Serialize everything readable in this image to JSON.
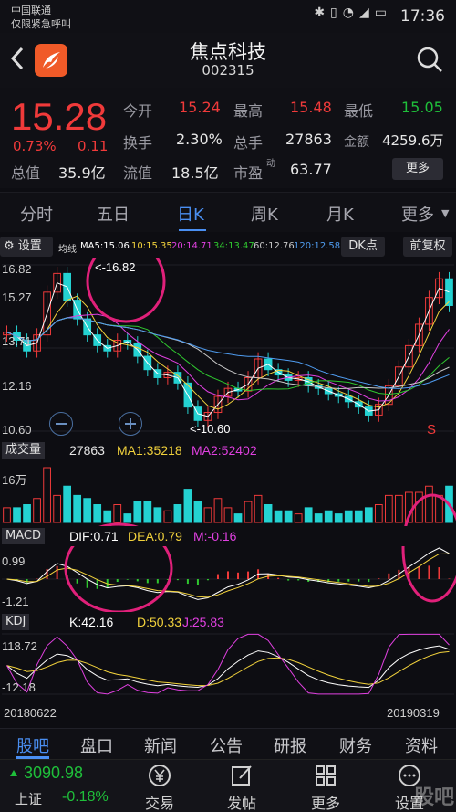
{
  "status_bar": {
    "carrier_line1": "中国联通",
    "carrier_line2": "仅限紧急呼叫",
    "icons": [
      "bluetooth-icon",
      "vibrate-icon",
      "wifi-icon",
      "signal-icon",
      "battery-icon"
    ],
    "time": "17:36"
  },
  "header": {
    "stock_name": "焦点科技",
    "stock_code": "002315"
  },
  "quote": {
    "price": "15.28",
    "change_pct": "0.73%",
    "change": "0.11",
    "rows": [
      [
        {
          "label": "今开",
          "value": "15.24",
          "color": "red"
        },
        {
          "label": "最高",
          "value": "15.48",
          "color": "red"
        },
        {
          "label": "最低",
          "value": "15.05",
          "color": "green"
        }
      ],
      [
        {
          "label": "换手",
          "value": "2.30%",
          "color": "white"
        },
        {
          "label": "总手",
          "value": "27863",
          "color": "white"
        },
        {
          "label": "金额",
          "value": "4259.6万",
          "color": "white"
        }
      ],
      [
        {
          "label": "总值",
          "value": "35.9亿",
          "color": "white"
        },
        {
          "label": "流值",
          "value": "18.5亿",
          "color": "white"
        },
        {
          "label": "市盈",
          "sup": "动",
          "value": "63.77",
          "color": "white"
        }
      ]
    ],
    "more_label": "更多"
  },
  "tabs": [
    "分时",
    "五日",
    "日K",
    "周K",
    "月K",
    "更多"
  ],
  "active_tab": 2,
  "ma": {
    "settings_label": "设置",
    "prefix": "均线",
    "items": [
      {
        "text": "MA5:15.06",
        "color": "#ffffff"
      },
      {
        "text": "10:15.35",
        "color": "#f2d23c"
      },
      {
        "text": "20:14.71",
        "color": "#e040e0"
      },
      {
        "text": "34:13.47",
        "color": "#2fc72f"
      },
      {
        "text": "60:12.76",
        "color": "#c8c8c8"
      },
      {
        "text": "120:12.58",
        "color": "#4f9cf0"
      }
    ],
    "dk_label": "DK点",
    "fq_label": "前复权"
  },
  "kline": {
    "y_labels": [
      "16.82",
      "15.27",
      "13.71",
      "12.16",
      "10.60"
    ],
    "high_mark": "<-16.82",
    "low_mark": "<-10.60",
    "s_marker": "S",
    "zoom_out_icon": "minus-icon",
    "zoom_in_icon": "plus-icon"
  },
  "volume": {
    "name": "成交量",
    "vol": "27863",
    "ma1": "MA1:35218",
    "ma2": "MA2:52402",
    "y_label": "16万"
  },
  "macd": {
    "name": "MACD",
    "dif": "DIF:0.71",
    "dea": "DEA:0.79",
    "m": "M:-0.16",
    "y_top": "0.99",
    "y_bottom": "-1.21"
  },
  "kdj": {
    "name": "KDJ",
    "k": "K:42.16",
    "d": "D:50.33",
    "j": "J:25.83",
    "y_top": "118.72",
    "y_bottom": "-12.18"
  },
  "dates": {
    "start": "20180622",
    "end": "20190319"
  },
  "bottom_tabs": [
    "股吧",
    "盘口",
    "新闻",
    "公告",
    "研报",
    "财务",
    "资料"
  ],
  "toolbar": {
    "index_value": "3090.98",
    "index_name": "上证",
    "index_change": "-0.18%",
    "items": [
      {
        "label": "交易",
        "icon": "yuan-trade-icon"
      },
      {
        "label": "发帖",
        "icon": "edit-post-icon"
      },
      {
        "label": "更多",
        "icon": "grid-more-icon"
      },
      {
        "label": "设置",
        "icon": "settings-dots-icon"
      }
    ]
  },
  "watermark": "股吧",
  "chart_data": {
    "type": "line",
    "title": "",
    "xlabel": "",
    "ylabel": "",
    "x_range": [
      "20180622",
      "20190319"
    ],
    "ylim": [
      10.6,
      16.82
    ],
    "y_ticks": [
      16.82,
      15.27,
      13.71,
      12.16,
      10.6
    ],
    "period_high": 16.82,
    "period_low": 10.6,
    "close_approx": [
      14.3,
      14.0,
      13.6,
      14.2,
      15.8,
      16.5,
      15.5,
      14.8,
      14.2,
      13.8,
      13.6,
      14.0,
      13.9,
      13.4,
      12.9,
      12.6,
      12.8,
      12.4,
      11.5,
      11.0,
      11.3,
      11.9,
      12.2,
      12.1,
      12.6,
      13.3,
      12.9,
      12.7,
      12.5,
      12.6,
      12.3,
      12.2,
      12.0,
      11.9,
      11.7,
      11.5,
      11.2,
      11.6,
      12.3,
      13.0,
      13.8,
      14.6,
      15.6,
      16.3,
      15.3
    ],
    "ma_last_values": {
      "MA5": 15.06,
      "MA10": 15.35,
      "MA20": 14.71,
      "MA34": 13.47,
      "MA60": 12.76,
      "MA120": 12.58
    },
    "macd_last": {
      "DIF": 0.71,
      "DEA": 0.79,
      "M": -0.16
    },
    "kdj_last": {
      "K": 42.16,
      "D": 50.33,
      "J": 25.83
    },
    "volume_last": {
      "VOL": 27863,
      "MA1": 35218,
      "MA2": 52402
    }
  }
}
